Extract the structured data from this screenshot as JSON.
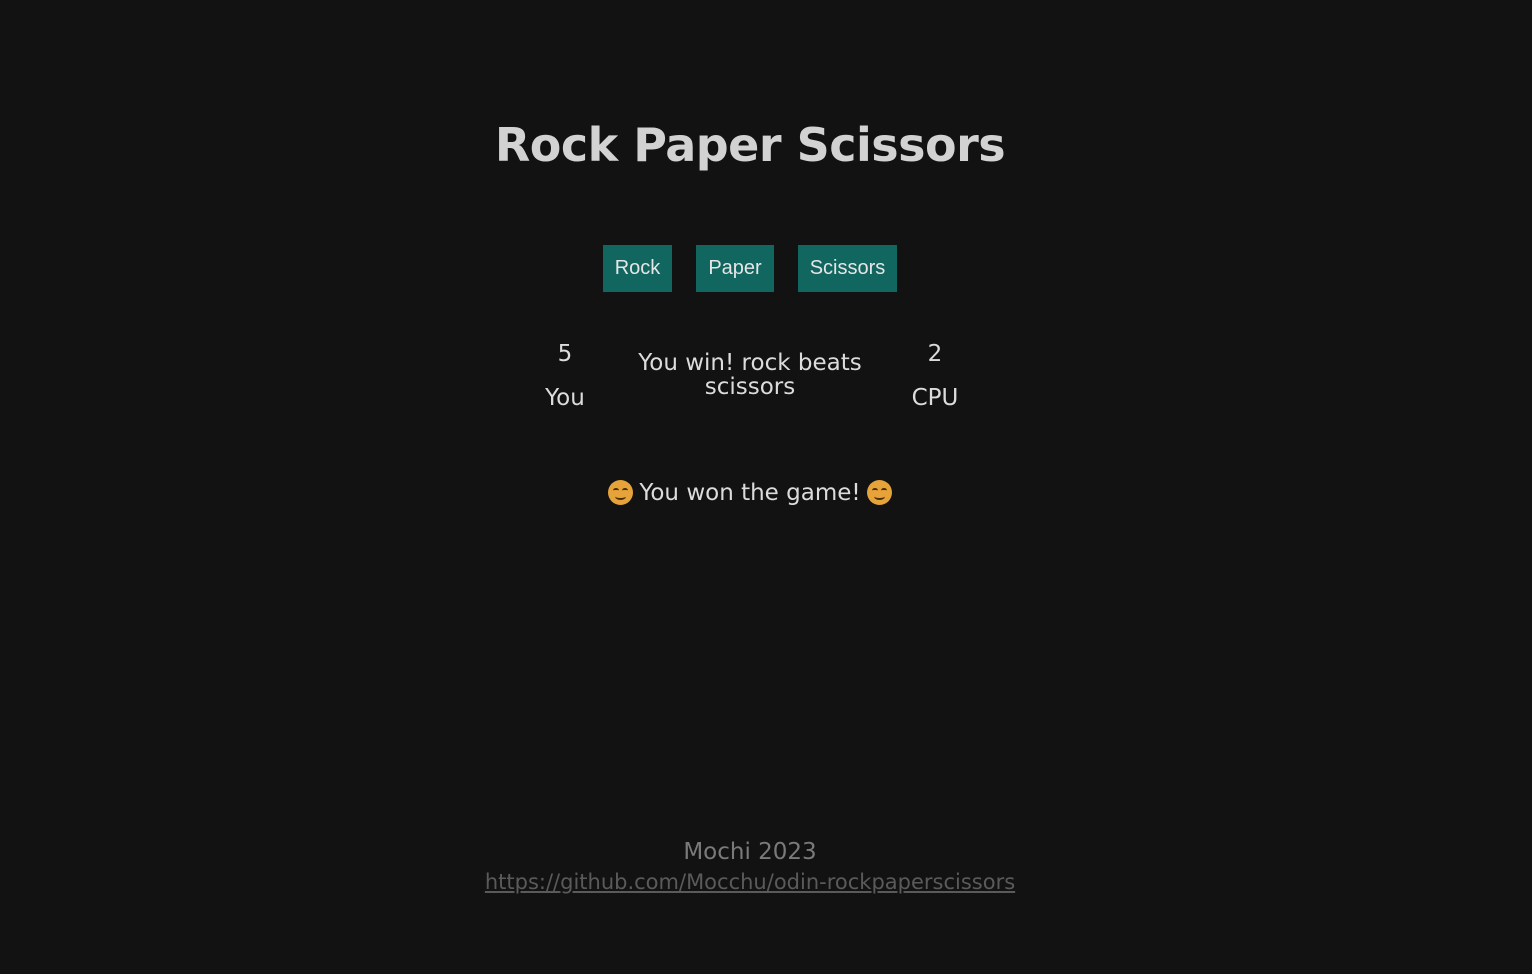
{
  "header": {
    "title": "Rock Paper Scissors"
  },
  "choices": {
    "rock_label": "Rock",
    "paper_label": "Paper",
    "scissors_label": "Scissors"
  },
  "scoreboard": {
    "player_score": "5",
    "player_label": "You",
    "round_message": "You win! rock beats scissors",
    "cpu_score": "2",
    "cpu_label": "CPU"
  },
  "result": {
    "text": "You won the game!",
    "icon": "smiling-face-icon"
  },
  "footer": {
    "credit": "Mochi 2023",
    "link_text": "https://github.com/Mocchu/odin-rockpaperscissors"
  },
  "colors": {
    "background": "#121212",
    "button": "#116660",
    "emoji": "#e5a33a"
  }
}
